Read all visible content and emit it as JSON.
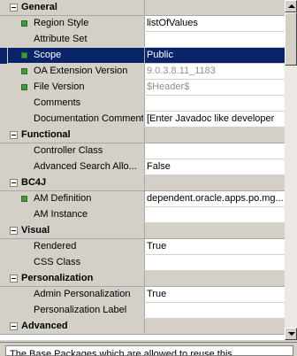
{
  "categories": [
    {
      "title": "General",
      "rows": [
        {
          "name": "Region Style",
          "value": "listOfValues",
          "required": true
        },
        {
          "name": "Attribute Set",
          "value": "",
          "required": false
        },
        {
          "name": "Scope",
          "value": "Public",
          "required": true,
          "selected": true
        },
        {
          "name": "OA Extension Version",
          "value": "9.0.3.8.11_1183",
          "required": true,
          "gray": true
        },
        {
          "name": "File Version",
          "value": "$Header$",
          "required": true,
          "gray": true
        },
        {
          "name": "Comments",
          "value": "",
          "required": false
        },
        {
          "name": "Documentation Comment",
          "value": "[Enter Javadoc like developer",
          "required": false
        }
      ]
    },
    {
      "title": "Functional",
      "rows": [
        {
          "name": "Controller Class",
          "value": "",
          "required": false
        },
        {
          "name": "Advanced Search Allo...",
          "value": "False",
          "required": false
        }
      ]
    },
    {
      "title": "BC4J",
      "rows": [
        {
          "name": "AM Definition",
          "value": "dependent.oracle.apps.po.mg...",
          "required": true
        },
        {
          "name": "AM Instance",
          "value": "",
          "required": false
        }
      ]
    },
    {
      "title": "Visual",
      "rows": [
        {
          "name": "Rendered",
          "value": "True",
          "required": false
        },
        {
          "name": "CSS Class",
          "value": "",
          "required": false
        }
      ]
    },
    {
      "title": "Personalization",
      "rows": [
        {
          "name": "Admin Personalization",
          "value": "True",
          "required": false
        },
        {
          "name": "Personalization Label",
          "value": "",
          "required": false
        }
      ]
    },
    {
      "title": "Advanced",
      "rows": []
    }
  ],
  "description": "The Base Packages which are allowed to reuse this",
  "colors": {
    "selection": "#0a246a",
    "required_marker": "#3d9a3d",
    "chrome": "#d4d0c8"
  }
}
